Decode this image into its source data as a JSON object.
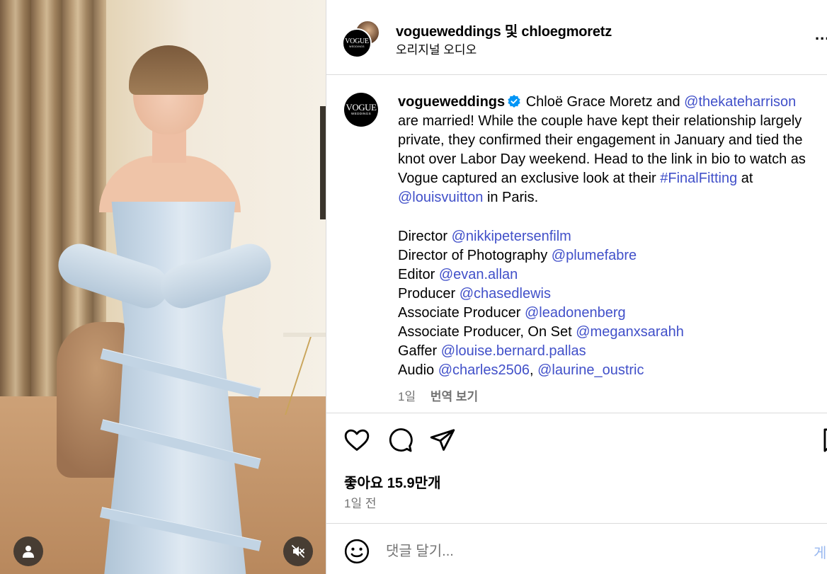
{
  "header": {
    "title": "vogueweddings 및 chloegmoretz",
    "audio": "오리지널 오디오",
    "more": "..."
  },
  "brand": {
    "logo_big": "VOGUE",
    "logo_small": "WEDDINGS"
  },
  "caption": {
    "username": "vogueweddings",
    "t1": "Chloë Grace Moretz and",
    "m1": "@thekateharrison",
    "t2": "are married! While the couple have kept their relationship largely",
    "t3": "private, they confirmed their engagement in January and tied the",
    "t4": "knot over Labor Day weekend. Head to the link in bio to watch as",
    "t5": "Vogue captured an exclusive look at their",
    "hashtag": "#FinalFitting",
    "t6": "at",
    "m2": "@louisvuitton",
    "t7": "in Paris."
  },
  "credits": [
    {
      "role": "Director",
      "handle": "@nikkipetersenfilm"
    },
    {
      "role": "Director of Photography",
      "handle": "@plumefabre"
    },
    {
      "role": "Editor",
      "handle": "@evan.allan"
    },
    {
      "role": "Producer",
      "handle": "@chasedlewis"
    },
    {
      "role": "Associate Producer",
      "handle": "@leadonenberg"
    },
    {
      "role": "Associate Producer, On Set",
      "handle": "@meganxsarahh"
    },
    {
      "role": "Gaffer",
      "handle": "@louise.bernard.pallas"
    },
    {
      "role": "Audio",
      "handle": "@charles2506",
      "separator": ",",
      "handle2": "@laurine_oustric"
    }
  ],
  "meta": {
    "age": "1일",
    "translate": "번역 보기"
  },
  "likes": "좋아요 15.9만개",
  "posted": "1일 전",
  "comment": {
    "placeholder": "댓글 달기...",
    "post": "게"
  },
  "colors": {
    "link": "#4150c9",
    "muted": "#737373",
    "verified": "#0095f6",
    "divider": "#dbdbdb"
  }
}
